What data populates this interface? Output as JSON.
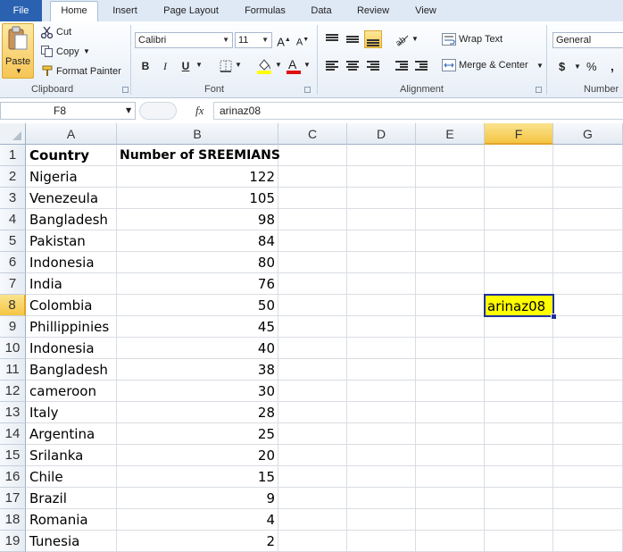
{
  "tabs": {
    "file": "File",
    "items": [
      "Home",
      "Insert",
      "Page Layout",
      "Formulas",
      "Data",
      "Review",
      "View"
    ],
    "active": "Home"
  },
  "ribbon": {
    "clipboard": {
      "paste": "Paste",
      "cut": "Cut",
      "copy": "Copy",
      "format_painter": "Format Painter",
      "label": "Clipboard"
    },
    "font": {
      "name": "Calibri",
      "size": "11",
      "bold": "B",
      "italic": "I",
      "underline": "U",
      "label": "Font"
    },
    "alignment": {
      "wrap_text": "Wrap Text",
      "merge_center": "Merge & Center",
      "label": "Alignment"
    },
    "number": {
      "format": "General",
      "currency": "$",
      "percent": "%",
      "comma": ",",
      "label": "Number"
    },
    "colors": {
      "fill": "#ffff00",
      "font": "#e01010",
      "accent": "#2a62b1"
    }
  },
  "formula_bar": {
    "name_box": "F8",
    "fx": "fx",
    "value": "arinaz08"
  },
  "columns": [
    "A",
    "B",
    "C",
    "D",
    "E",
    "F",
    "G"
  ],
  "selected_column": "F",
  "selected_row": "8",
  "rows": [
    "1",
    "2",
    "3",
    "4",
    "5",
    "6",
    "7",
    "8",
    "9",
    "10",
    "11",
    "12",
    "13",
    "14",
    "15",
    "16",
    "17",
    "18",
    "19"
  ],
  "sheet": {
    "headers": {
      "country": "Country",
      "number": "Number of SREEMIANS"
    },
    "data": [
      {
        "country": "Nigeria",
        "number": "122"
      },
      {
        "country": "Venezeula",
        "number": "105"
      },
      {
        "country": "Bangladesh",
        "number": "98"
      },
      {
        "country": "Pakistan",
        "number": "84"
      },
      {
        "country": "Indonesia",
        "number": "80"
      },
      {
        "country": "India",
        "number": "76"
      },
      {
        "country": "Colombia",
        "number": "50"
      },
      {
        "country": "Phillippinies",
        "number": "45"
      },
      {
        "country": "Indonesia",
        "number": "40"
      },
      {
        "country": "Bangladesh",
        "number": "38"
      },
      {
        "country": "cameroon",
        "number": "30"
      },
      {
        "country": "Italy",
        "number": "28"
      },
      {
        "country": "Argentina",
        "number": "25"
      },
      {
        "country": "Srilanka",
        "number": "20"
      },
      {
        "country": "Chile",
        "number": "15"
      },
      {
        "country": "Brazil",
        "number": "9"
      },
      {
        "country": "Romania",
        "number": "4"
      },
      {
        "country": "Tunesia",
        "number": "2"
      }
    ],
    "active_cell": {
      "ref": "F8",
      "value": "arinaz08",
      "fill": "#ffff00"
    }
  }
}
